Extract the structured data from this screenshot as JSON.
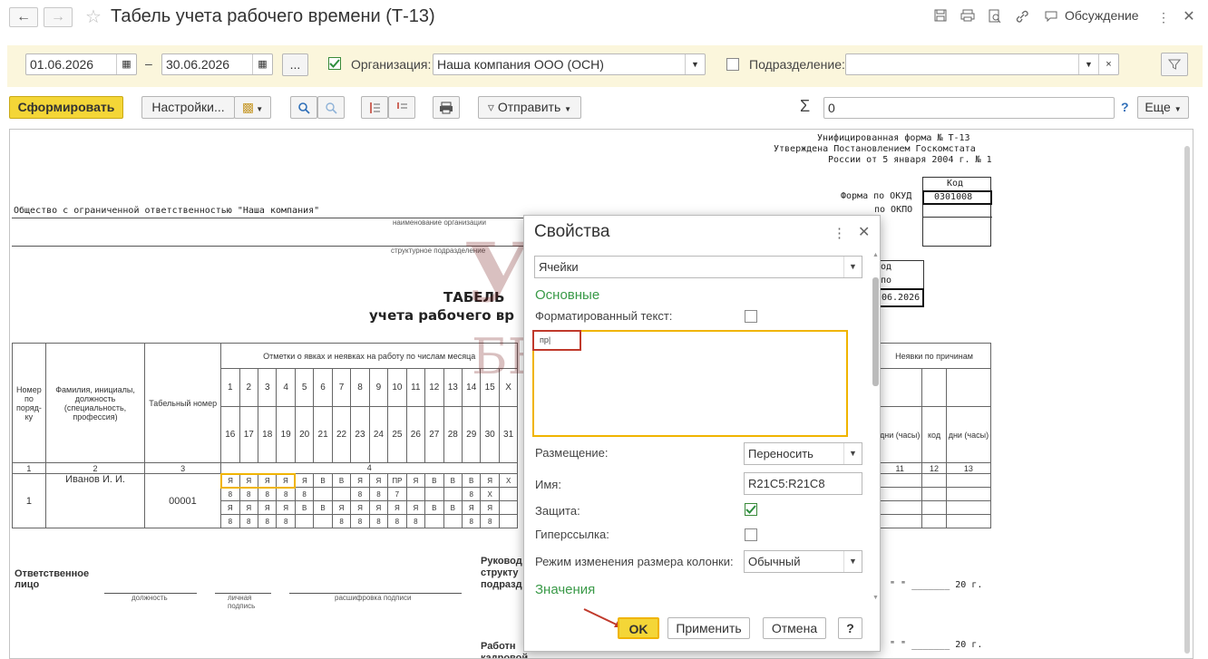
{
  "window": {
    "title": "Табель учета рабочего времени (Т-13)",
    "discuss_label": "Обсуждение"
  },
  "filters": {
    "date_from": "01.06.2026",
    "date_sep": "–",
    "date_to": "30.06.2026",
    "ellipsis": "...",
    "org_label": "Организация:",
    "org_value": "Наша компания ООО (ОСН)",
    "org_checked": true,
    "dept_label": "Подразделение:",
    "dept_value": "",
    "dept_checked": false
  },
  "toolbar": {
    "generate": "Сформировать",
    "settings": "Настройки...",
    "send": "Отправить",
    "sigma": "Σ",
    "sum_value": "0",
    "help": "?",
    "more": "Еще"
  },
  "report": {
    "form_line1": "Унифицированная форма № Т-13",
    "form_line2": "Утверждена Постановлением Госкомстата",
    "form_line3": "России от 5 января 2004 г. № 1",
    "code_header": "Код",
    "okud_label": "Форма по ОКУД",
    "okud_value": "0301008",
    "okpo_label": "по ОКПО",
    "org_name": "Общество с ограниченной ответственностью \"Наша компания\"",
    "org_caption": "наименование организации",
    "dept_caption": "структурное подразделение",
    "title1": "ТАБЕЛЬ",
    "title2": "учета  рабочего вр",
    "side_od": "од",
    "side_po": "по",
    "side_date": "06.2026",
    "col_number": "Номер по поряд-ку",
    "col_fio": "Фамилия, инициалы, должность (специальность, профессия)",
    "col_tab": "Табельный номер",
    "col_marks": "Отметки о явках и неявках на работу по числам месяца",
    "col_absence": "Неявки по причинам",
    "col_days": "дни (часы)",
    "col_code": "код",
    "col_days2": "дни (часы)",
    "days_row1": [
      "1",
      "2",
      "3",
      "4",
      "5",
      "6",
      "7",
      "8",
      "9",
      "10",
      "11",
      "12",
      "13",
      "14",
      "15",
      "X"
    ],
    "days_row2": [
      "16",
      "17",
      "18",
      "19",
      "20",
      "21",
      "22",
      "23",
      "24",
      "25",
      "26",
      "27",
      "28",
      "29",
      "30",
      "31"
    ],
    "num_row": [
      "1",
      "2",
      "3",
      "4",
      "11",
      "12",
      "13"
    ],
    "emp_num": "1",
    "emp_name": "Иванов И. И.",
    "emp_tab": "00001",
    "marks_r1": [
      "Я",
      "Я",
      "Я",
      "Я",
      "Я",
      "В",
      "В",
      "Я",
      "Я",
      "ПР",
      "Я",
      "В",
      "В",
      "В",
      "Я",
      "X"
    ],
    "marks_r2": [
      "8",
      "8",
      "8",
      "8",
      "8",
      "",
      "",
      "8",
      "8",
      "7",
      "",
      "",
      "",
      "8",
      "X",
      ""
    ],
    "marks_r3": [
      "Я",
      "Я",
      "Я",
      "Я",
      "В",
      "В",
      "Я",
      "Я",
      "Я",
      "Я",
      "Я",
      "В",
      "В",
      "Я",
      "Я",
      ""
    ],
    "marks_r4": [
      "8",
      "8",
      "8",
      "8",
      "",
      "",
      "8",
      "8",
      "8",
      "8",
      "8",
      "",
      "",
      "8",
      "8",
      ""
    ],
    "resp_label": "Ответственное лицо",
    "sig_position": "должность",
    "sig_sign": "личная подпись",
    "sig_decode": "расшифровка подписи",
    "head_label": "Руковод структу подразд",
    "worker_label": "Работн кадровой",
    "date_tail1": "\" \"  _______  20   г.",
    "date_tail2": "\" \"  _______  20   г."
  },
  "dialog": {
    "title": "Свойства",
    "selector": "Ячейки",
    "section_main": "Основные",
    "formatted_label": "Форматированный текст:",
    "text_value": "пр|",
    "placement_label": "Размещение:",
    "placement_value": "Переносить",
    "name_label": "Имя:",
    "name_value": "R21C5:R21C8",
    "protect_label": "Защита:",
    "protect_checked": true,
    "hyperlink_label": "Гиперссылка:",
    "resize_label": "Режим изменения размера колонки:",
    "resize_value": "Обычный",
    "section_values": "Значения",
    "ok": "OK",
    "apply": "Применить",
    "cancel": "Отмена",
    "help": "?"
  },
  "watermark": {
    "line1": "УЧЕТ",
    "line2": "БЕЗ ЗАБОТ"
  },
  "colors": {
    "accent_yellow": "#f4d637",
    "filter_bg": "#fbf6dc",
    "section_green": "#3a9a48",
    "highlight_orange": "#f0b400",
    "marker_red": "#c0392b"
  }
}
